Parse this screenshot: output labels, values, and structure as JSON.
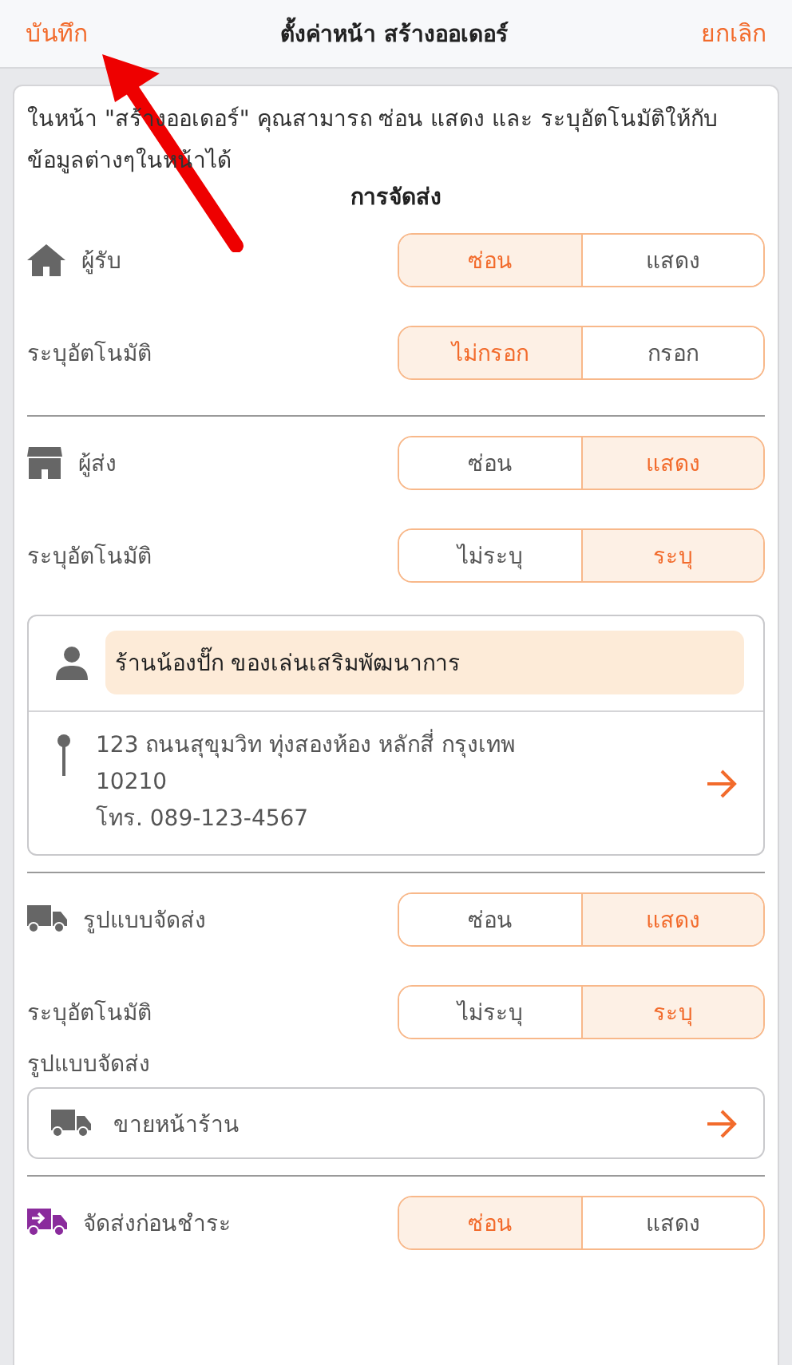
{
  "header": {
    "save": "บันทึก",
    "title": "ตั้งค่าหน้า สร้างออเดอร์",
    "cancel": "ยกเลิก"
  },
  "intro": "ในหน้า \"สร้างออเดอร์\" คุณสามารถ ซ่อน แสดง และ ระบุอัตโนมัติให้กับข้อมูลต่างๆในหน้าได้",
  "section_title": "การจัดส่ง",
  "sections": [
    {
      "kind": "recipient",
      "toggle": {
        "label": "ผู้รับ",
        "options": [
          {
            "label": "ซ่อน",
            "selected": true
          },
          {
            "label": "แสดง",
            "selected": false
          }
        ]
      },
      "auto": {
        "label": "ระบุอัตโนมัติ",
        "options": [
          {
            "label": "ไม่กรอก",
            "selected": true
          },
          {
            "label": "กรอก",
            "selected": false
          }
        ]
      }
    },
    {
      "kind": "sender",
      "toggle": {
        "label": "ผู้ส่ง",
        "options": [
          {
            "label": "ซ่อน",
            "selected": false
          },
          {
            "label": "แสดง",
            "selected": true
          }
        ]
      },
      "auto": {
        "label": "ระบุอัตโนมัติ",
        "options": [
          {
            "label": "ไม่ระบุ",
            "selected": false
          },
          {
            "label": "ระบุ",
            "selected": true
          }
        ]
      },
      "contact": {
        "name": "ร้านน้องปั๊ก ของเล่นเสริมพัฒนาการ",
        "address_lines": [
          "123 ถนนสุขุมวิท ทุ่งสองห้อง หลักสี่ กรุงเทพ",
          "10210",
          "โทร. 089-123-4567"
        ]
      }
    },
    {
      "kind": "shipping",
      "toggle": {
        "label": "รูปแบบจัดส่ง",
        "options": [
          {
            "label": "ซ่อน",
            "selected": false
          },
          {
            "label": "แสดง",
            "selected": true
          }
        ]
      },
      "auto": {
        "label": "ระบุอัตโนมัติ",
        "options": [
          {
            "label": "ไม่ระบุ",
            "selected": false
          },
          {
            "label": "ระบุ",
            "selected": true
          }
        ]
      },
      "method": {
        "label": "รูปแบบจัดส่ง",
        "value": "ขายหน้าร้าน"
      }
    },
    {
      "kind": "cod",
      "toggle": {
        "label": "จัดส่งก่อนชำระ",
        "options": [
          {
            "label": "ซ่อน",
            "selected": true
          },
          {
            "label": "แสดง",
            "selected": false
          }
        ]
      }
    }
  ]
}
